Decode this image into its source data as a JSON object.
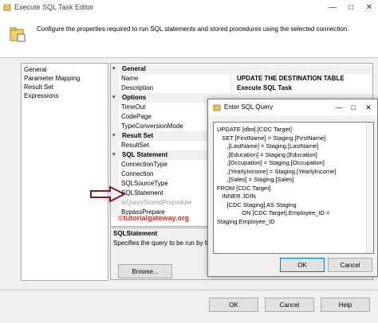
{
  "window": {
    "title": "Execute SQL Task Editor"
  },
  "header": {
    "description": "Configure the properties required to run SQL statements and stored procedures using the selected connection."
  },
  "nav": {
    "items": [
      "General",
      "Parameter Mapping",
      "Result Set",
      "Expressions"
    ]
  },
  "grid": {
    "general": "General",
    "name_label": "Name",
    "name_value": "UPDATE THE DESTINATION TABLE",
    "description_label": "Description",
    "description_value": "Execute SQL Task",
    "options": "Options",
    "timeout": "TimeOut",
    "codepage": "CodePage",
    "typeconv": "TypeConversionMode",
    "resultset": "Result Set",
    "resultset_prop": "ResultSet",
    "sqlstatement_cat": "SQL Statement",
    "connectiontype": "ConnectionType",
    "connection": "Connection",
    "sqlsourcetype": "SQLSourceType",
    "sqlstatement": "SQLStatement",
    "isquerysp": "IsQueryStoredProcedure",
    "bypassprepare": "BypassPrepare"
  },
  "descbox": {
    "title": "SQLStatement",
    "text": "Specifies the query to be run by the"
  },
  "buttons": {
    "browse": "Browse...",
    "ok": "OK",
    "cancel": "Cancel",
    "help": "Help"
  },
  "dialog": {
    "title": "Enter SQL Query",
    "ok": "OK",
    "cancel": "Cancel",
    "query_lines": [
      "UPDATE [dbo].[CDC Target]",
      "   SET [FirstName] = Staging.[FirstName]",
      "      ,[LastName] = Staging.[LastName]",
      "      ,[Education] = Staging.[Education]",
      "      ,[Occupation] = Staging.[Occupation]",
      "      ,[YearlyIncome] = Staging.[YearlyIncome]",
      "      ,[Sales] = Staging.[Sales]",
      "FROM [CDC Target]",
      "   INNER JOIN",
      "      [CDC Staging] AS Staging",
      "               ON [CDC Target].Employee_ID =",
      "Staging.Employee_ID"
    ]
  },
  "watermark": "©tutorialgateway.org",
  "colors": {
    "accent_border": "#0078d7",
    "arrow": "#8b1a1a"
  }
}
